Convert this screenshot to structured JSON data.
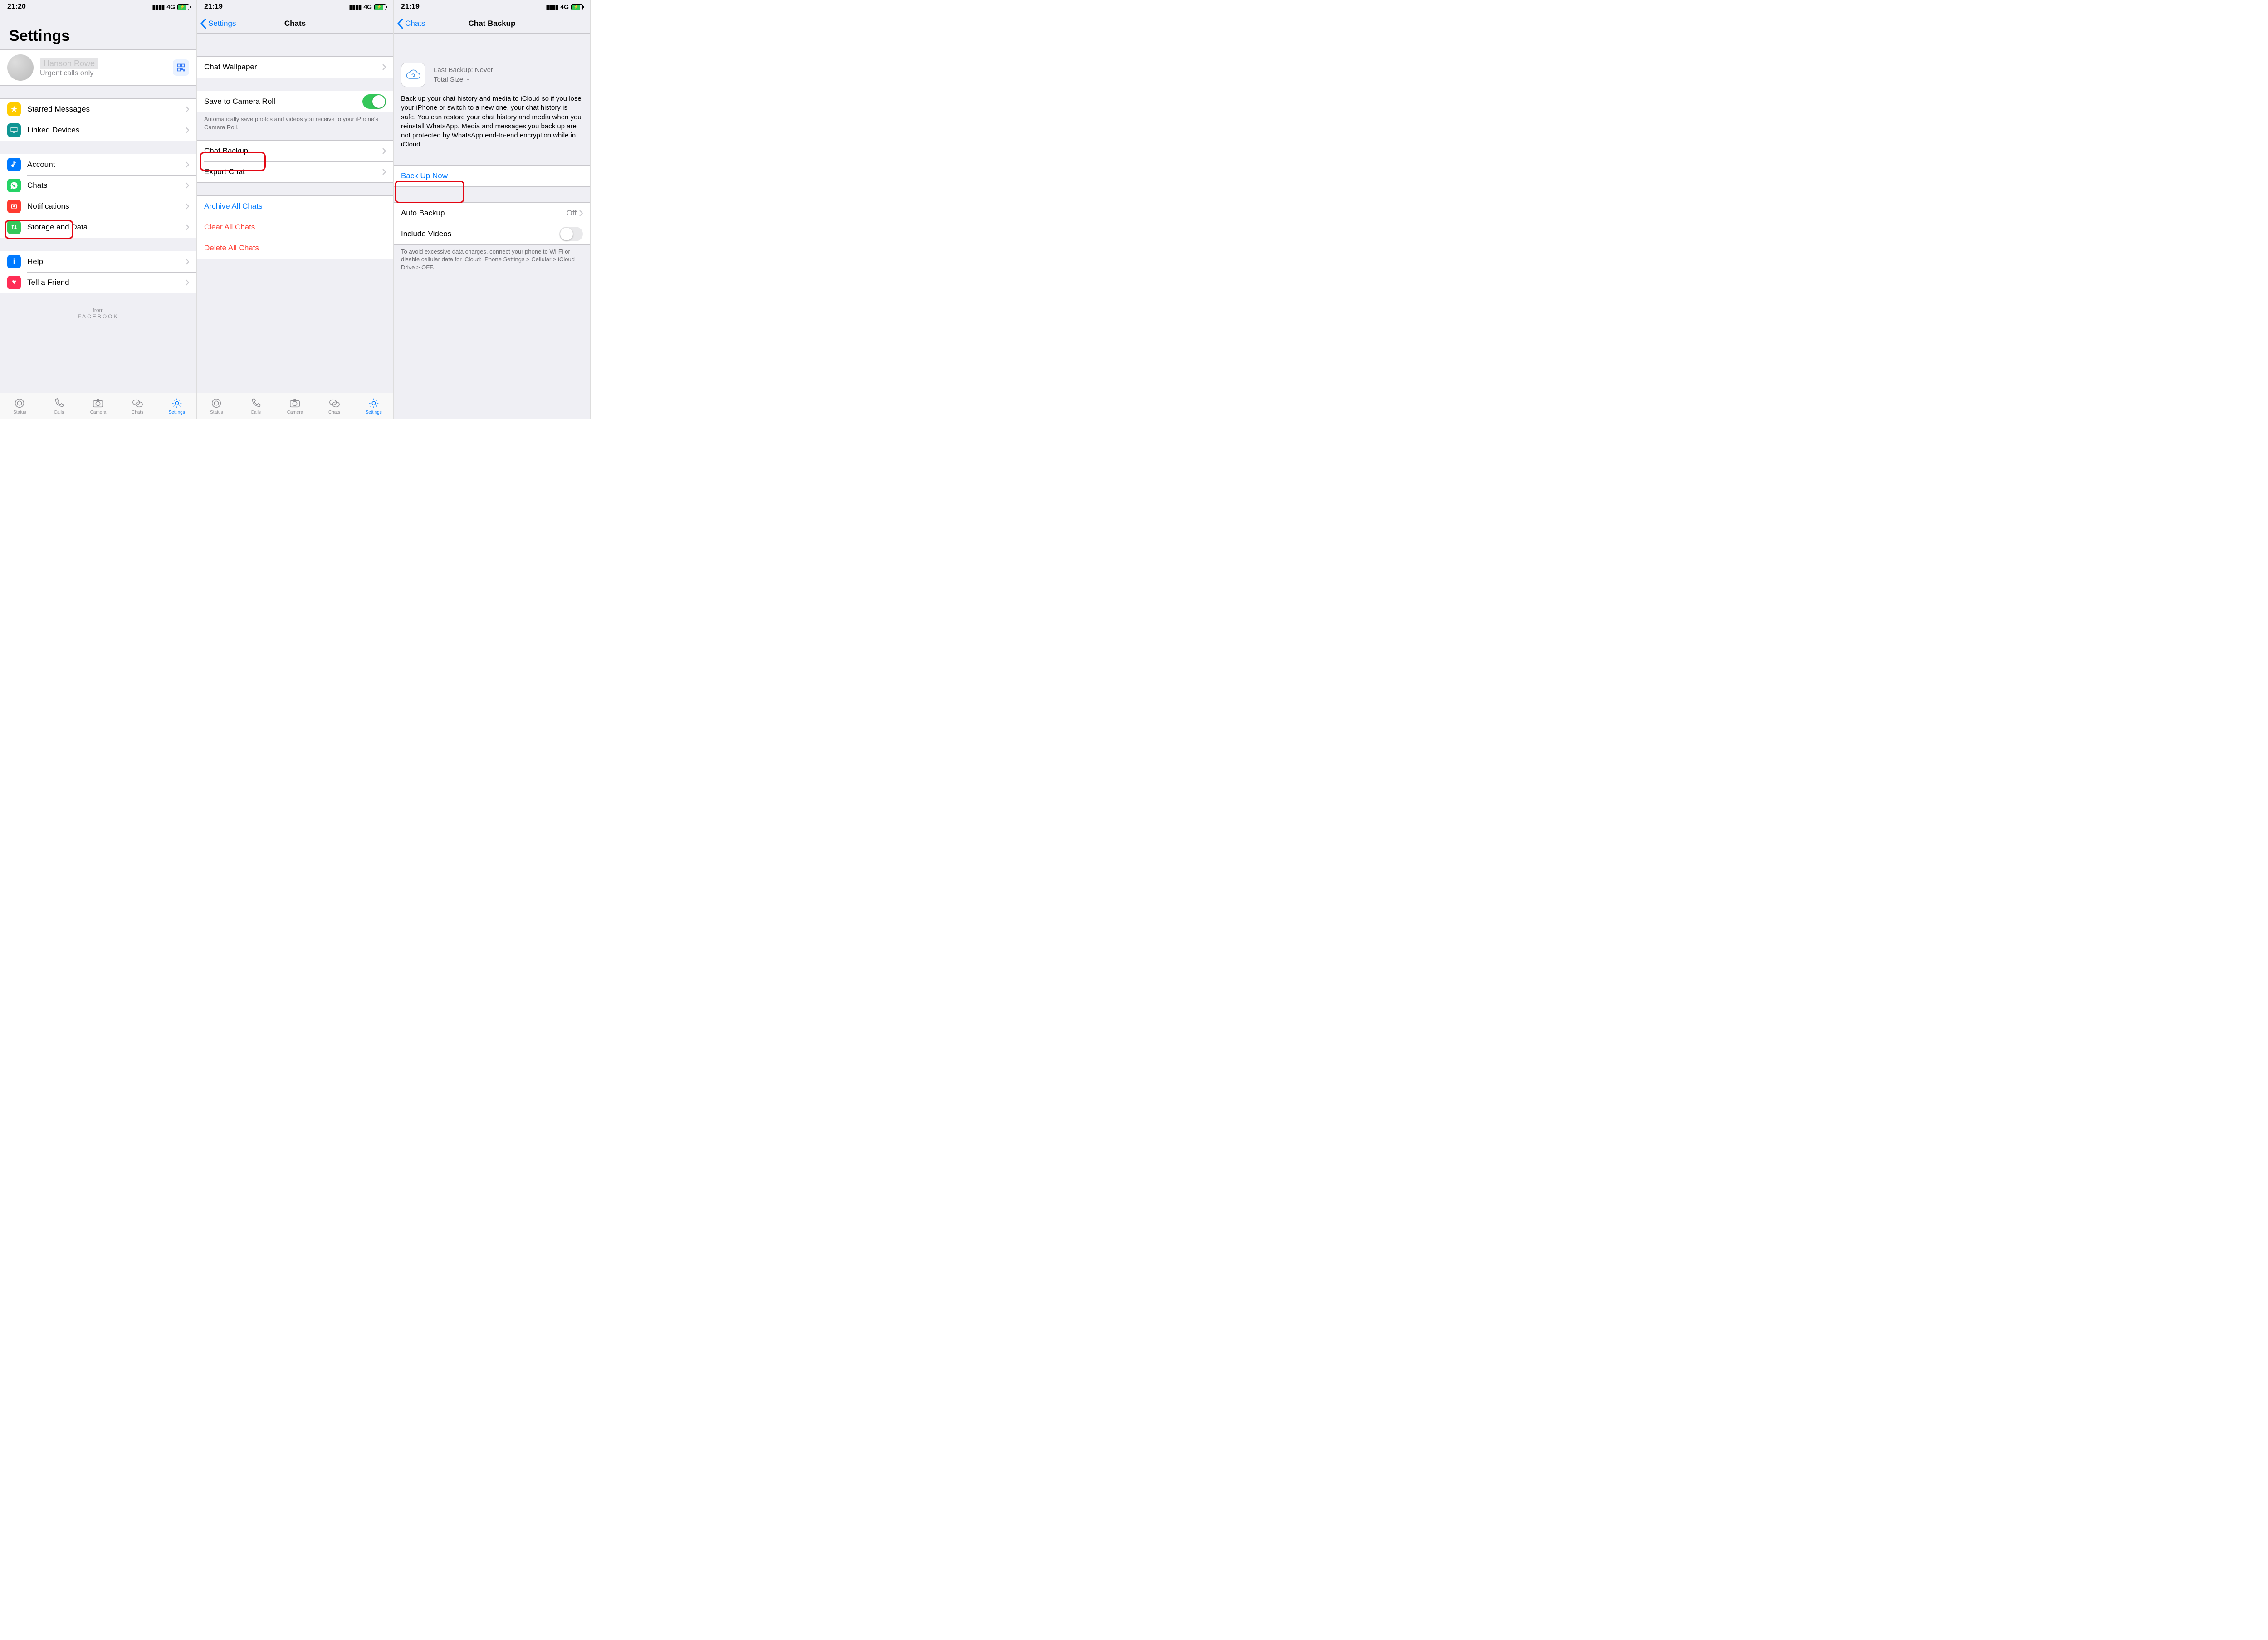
{
  "screen1": {
    "status": {
      "time": "21:20",
      "network": "4G"
    },
    "title": "Settings",
    "profile": {
      "name": "Hanson Rowe",
      "status": "Urgent calls only"
    },
    "group1": [
      {
        "label": "Starred Messages",
        "color": "#ffcc00",
        "icon": "star"
      },
      {
        "label": "Linked Devices",
        "color": "#0f9593",
        "icon": "monitor"
      }
    ],
    "group2": [
      {
        "label": "Account",
        "color": "#007aff",
        "icon": "key"
      },
      {
        "label": "Chats",
        "color": "#25d366",
        "icon": "whatsapp"
      },
      {
        "label": "Notifications",
        "color": "#ff3b30",
        "icon": "bell"
      },
      {
        "label": "Storage and Data",
        "color": "#34c759",
        "icon": "updown"
      }
    ],
    "group3": [
      {
        "label": "Help",
        "color": "#007aff",
        "icon": "info"
      },
      {
        "label": "Tell a Friend",
        "color": "#ff2d55",
        "icon": "heart"
      }
    ],
    "from": {
      "small": "from",
      "brand": "FACEBOOK"
    }
  },
  "screen2": {
    "status": {
      "time": "21:19",
      "network": "4G"
    },
    "nav": {
      "back": "Settings",
      "title": "Chats"
    },
    "rows": {
      "wallpaper": "Chat Wallpaper",
      "save_camera": "Save to Camera Roll",
      "save_camera_note": "Automatically save photos and videos you receive to your iPhone's Camera Roll.",
      "backup": "Chat Backup",
      "export": "Export Chat",
      "archive": "Archive All Chats",
      "clear": "Clear All Chats",
      "delete": "Delete All Chats"
    }
  },
  "screen3": {
    "status": {
      "time": "21:19",
      "network": "4G"
    },
    "nav": {
      "back": "Chats",
      "title": "Chat Backup"
    },
    "cloud": {
      "last_label": "Last Backup:",
      "last_value": "Never",
      "size_label": "Total Size:",
      "size_value": "-"
    },
    "desc": "Back up your chat history and media to iCloud so if you lose your iPhone or switch to a new one, your chat history is safe. You can restore your chat history and media when you reinstall WhatsApp. Media and messages you back up are not protected by WhatsApp end-to-end encryption while in iCloud.",
    "backup_now": "Back Up Now",
    "auto_backup": {
      "label": "Auto Backup",
      "value": "Off"
    },
    "include_videos": "Include Videos",
    "note": "To avoid excessive data charges, connect your phone to Wi-Fi or disable cellular data for iCloud: iPhone Settings > Cellular > iCloud Drive > OFF."
  },
  "tabs": [
    {
      "label": "Status"
    },
    {
      "label": "Calls"
    },
    {
      "label": "Camera"
    },
    {
      "label": "Chats"
    },
    {
      "label": "Settings"
    }
  ]
}
